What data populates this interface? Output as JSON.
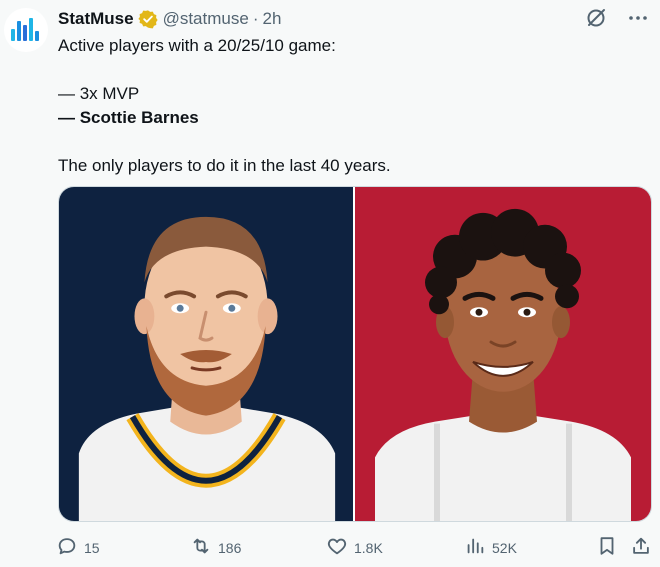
{
  "author": {
    "name": "StatMuse",
    "handle": "@statmuse",
    "separator": "·",
    "time": "2h"
  },
  "tweet": {
    "line1": "Active players with a 20/25/10 game:",
    "line2": "— 3x MVP",
    "line3": "— Scottie Barnes",
    "line4": "The only players to do it in the last 40 years."
  },
  "media": {
    "left_bg": "#0e2240",
    "right_bg": "#b81c34"
  },
  "metrics": {
    "replies": "15",
    "reposts": "186",
    "likes": "1.8K",
    "views": "52K"
  },
  "colors": {
    "text": "#0f1419",
    "secondary": "#536471",
    "verified": "#e2b719",
    "brand": "#2b7fd8"
  }
}
